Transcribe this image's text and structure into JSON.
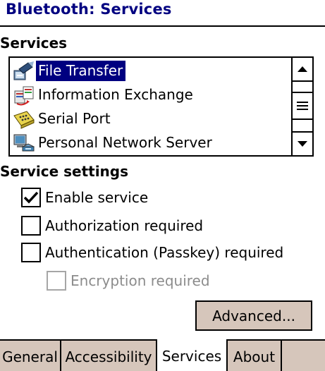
{
  "window": {
    "title": "Bluetooth: Services"
  },
  "services": {
    "label": "Services",
    "items": [
      {
        "label": "File Transfer",
        "icon": "file-transfer-icon",
        "selected": true
      },
      {
        "label": "Information Exchange",
        "icon": "information-exchange-icon",
        "selected": false
      },
      {
        "label": "Serial Port",
        "icon": "serial-port-icon",
        "selected": false
      },
      {
        "label": "Personal Network Server",
        "icon": "network-server-icon",
        "selected": false
      }
    ]
  },
  "settings": {
    "label": "Service settings",
    "enable_service": {
      "label": "Enable service",
      "checked": true
    },
    "authorization": {
      "label": "Authorization required",
      "checked": false
    },
    "authentication": {
      "label": "Authentication (Passkey) required",
      "checked": false
    },
    "encryption": {
      "label": "Encryption required",
      "checked": false,
      "enabled": false
    }
  },
  "buttons": {
    "advanced": "Advanced..."
  },
  "tabs": [
    {
      "label": "General",
      "active": false
    },
    {
      "label": "Accessibility",
      "active": false
    },
    {
      "label": "Services",
      "active": true
    },
    {
      "label": "About",
      "active": false
    }
  ],
  "colors": {
    "title": "#000080",
    "selection": "#000080",
    "button_face": "#d6c6bb",
    "disabled_text": "#8c8c8c"
  }
}
